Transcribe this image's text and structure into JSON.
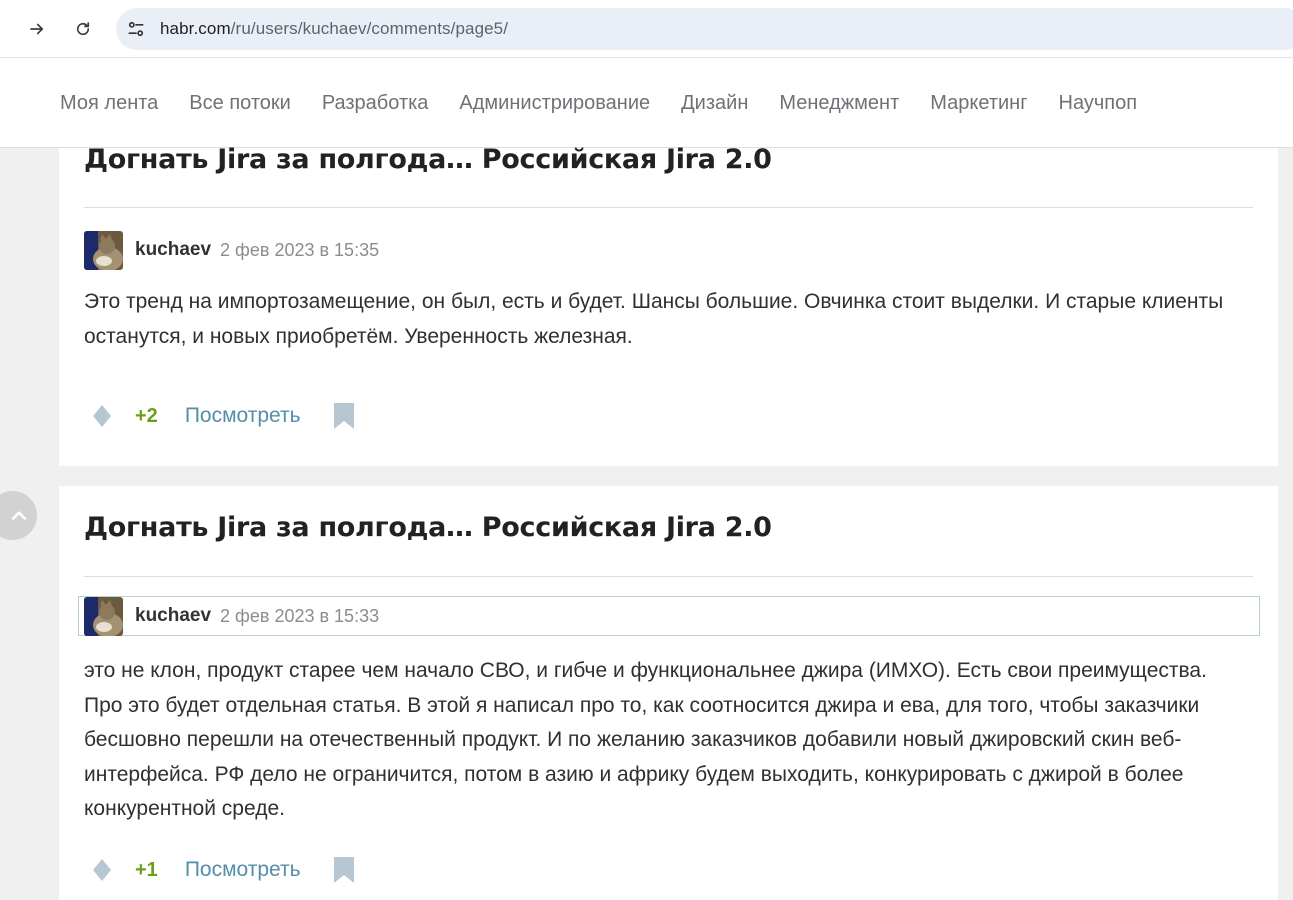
{
  "browser": {
    "url_host": "habr.com",
    "url_path": "/ru/users/kuchaev/comments/page5/"
  },
  "header": {
    "flows": [
      "Моя лента",
      "Все потоки",
      "Разработка",
      "Администрирование",
      "Дизайн",
      "Менеджмент",
      "Маркетинг",
      "Научпоп"
    ]
  },
  "comments": [
    {
      "post_title": "Догнать Jira за полгода… Российская Jira 2.0",
      "author": "kuchaev",
      "date": "2 фев 2023 в 15:35",
      "text": "Это тренд на импортозамещение, он был, есть и будет. Шансы большие. Овчинка стоит выделки. И старые клиенты останутся, и новых приобретём. Уверенность железная.",
      "score": "+2",
      "view_label": "Посмотреть"
    },
    {
      "post_title": "Догнать Jira за полгода… Российская Jira 2.0",
      "author": "kuchaev",
      "date": "2 фев 2023 в 15:33",
      "text": "это не клон, продукт старее чем начало СВО, и гибче и функциональнее джира (ИМХО). Есть свои преимущества. Про это будет отдельная статья. В этой я написал про то, как соотносится джира и ева, для того, чтобы заказчики бесшовно перешли на отечественный продукт. И по желанию заказчиков добавили новый джировский скин веб-интерфейса. РФ дело не ограничится, потом в азию и африку будем выходить, конкурировать с джирой в более конкурентной среде.",
      "score": "+1",
      "view_label": "Посмотреть"
    }
  ],
  "colors": {
    "score_positive": "#6d9f1c",
    "link": "#548eaa",
    "icon_muted": "#b7c7d2"
  },
  "icons": {
    "forward": "arrow-right-icon",
    "reload": "reload-icon",
    "site_info": "tune-icon",
    "vote": "vote-diamond-icon",
    "bookmark": "bookmark-icon",
    "scroll_up": "chevron-up-icon"
  }
}
